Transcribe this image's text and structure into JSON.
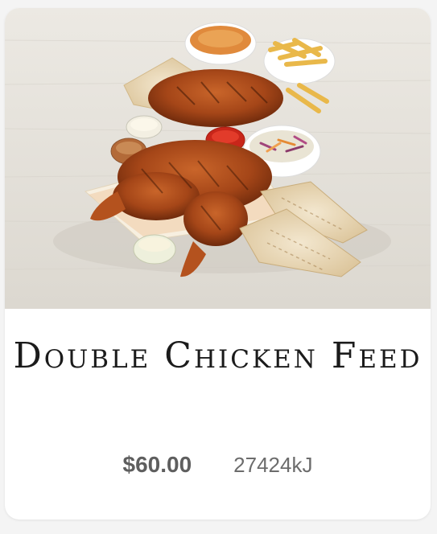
{
  "product": {
    "title": "Double Chicken Feed",
    "price": "$60.00",
    "energy": "27424kJ",
    "image": "double-chicken-feed-photo"
  }
}
